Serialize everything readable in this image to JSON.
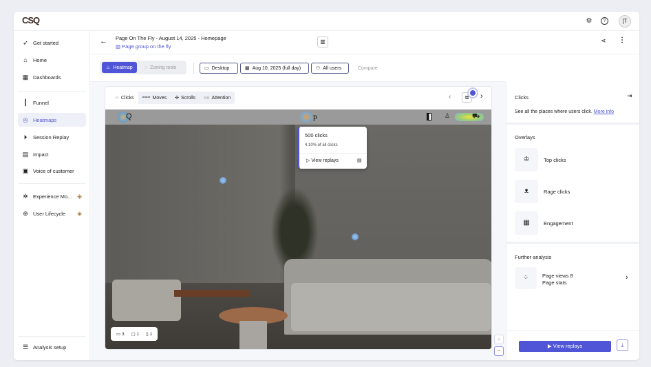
{
  "logo": "CSQ",
  "topbar": {
    "icons": [
      "puzzle-icon",
      "help-icon"
    ],
    "avatar": "[T"
  },
  "sidebar": {
    "items": [
      {
        "label": "Get started",
        "icon": "rocket-icon"
      },
      {
        "label": "Home",
        "icon": "home-icon"
      },
      {
        "label": "Dashboards",
        "icon": "dashboard-icon"
      },
      {
        "label": "Funnel",
        "icon": "funnel-icon"
      },
      {
        "label": "Heatmaps",
        "icon": "heatmap-icon",
        "active": true
      },
      {
        "label": "Session Replay",
        "icon": "play-icon"
      },
      {
        "label": "Impact",
        "icon": "impact-icon"
      },
      {
        "label": "Voice of customer",
        "icon": "voc-icon"
      },
      {
        "label": "Experience Mo...",
        "icon": "bug-icon",
        "premium": true
      },
      {
        "label": "User Lifecycle",
        "icon": "lifecycle-icon",
        "premium": true
      }
    ],
    "footer": "Analysis setup"
  },
  "header": {
    "title": "Page On The Fly - August 14, 2025 - Homepage",
    "subtitle": "Page group on the fly"
  },
  "toolbar": {
    "heatmap": "Heatmap",
    "zoning": "Zoning tools",
    "device": "Desktop",
    "date": "Aug 10, 2025 (full day)",
    "segment": "All users",
    "compare": "Compare"
  },
  "tabs": [
    "Clicks",
    "Moves",
    "Scrolls",
    "Attention"
  ],
  "site": {
    "title_fragment": "p"
  },
  "popup": {
    "clicks": "500 clicks",
    "share": "4.10% of all clicks",
    "action": "View replays"
  },
  "devices": [
    {
      "icon": "desktop-icon",
      "count": "3"
    },
    {
      "icon": "tablet-icon",
      "count": "1"
    },
    {
      "icon": "mobile-icon",
      "count": "1"
    }
  ],
  "zoom": {
    "in": "+",
    "out": "−"
  },
  "panel": {
    "title": "Clicks",
    "desc": "See all the places where users click.",
    "link": "More info",
    "overlays_title": "Overlays",
    "overlays": [
      {
        "label": "Top clicks",
        "icon": "trophy-icon"
      },
      {
        "label": "Rage clicks",
        "icon": "rage-icon"
      },
      {
        "label": "Engagement",
        "icon": "grid-icon"
      }
    ],
    "further_title": "Further analysis",
    "further": {
      "line1": "Page views 8",
      "line2": "Page stats"
    },
    "cta": "View replays"
  },
  "colors": {
    "accent": "#4f55d6"
  }
}
